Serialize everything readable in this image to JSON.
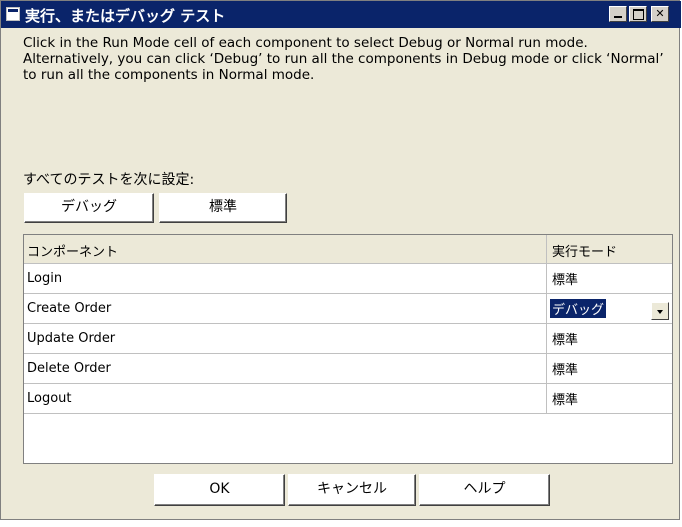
{
  "window": {
    "title": "実行、またはデバッグ テスト"
  },
  "description": "Click in the Run Mode cell of each component to select Debug or Normal run mode. Alternatively, you can click ‘Debug’ to run all the components in Debug mode or click ‘Normal’ to run all the components in Normal mode.",
  "set_all": {
    "label": "すべてのテストを次に設定:",
    "debug_label": "デバッグ",
    "normal_label": "標準"
  },
  "grid": {
    "columns": [
      "コンポーネント",
      "実行モード"
    ],
    "rows": [
      {
        "component": "Login",
        "mode": "標準"
      },
      {
        "component": "Create Order",
        "mode": "デバッグ",
        "selected": true
      },
      {
        "component": "Update Order",
        "mode": "標準"
      },
      {
        "component": "Delete Order",
        "mode": "標準"
      },
      {
        "component": "Logout",
        "mode": "標準"
      }
    ]
  },
  "buttons": {
    "ok": "OK",
    "cancel": "キャンセル",
    "help": "ヘルプ"
  },
  "colors": {
    "titlebar": "#0a246a",
    "selection": "#0a246a",
    "dialog_bg": "#ece9d8"
  }
}
